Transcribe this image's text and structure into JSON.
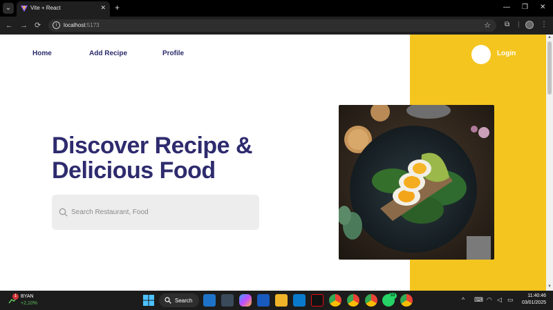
{
  "browser": {
    "tab_title": "Vite + React",
    "tab_close": "✕",
    "new_tab": "+",
    "url_host": "localhost",
    "url_port": ":5173",
    "back": "←",
    "forward": "→",
    "reload": "⟳",
    "star": "☆",
    "window_min": "—",
    "window_max": "❐",
    "window_close": "✕"
  },
  "page": {
    "nav": {
      "home": "Home",
      "add_recipe": "Add Recipe",
      "profile": "Profile",
      "login": "Login"
    },
    "hero": {
      "title": "Discover Recipe & Delicious Food"
    },
    "search": {
      "placeholder": "Search Restaurant, Food"
    },
    "colors": {
      "accent_yellow": "#f4c51f",
      "title_navy": "#2e2b6e"
    }
  },
  "taskbar": {
    "stock_name": "BYAN",
    "stock_change": "+2,10%",
    "stock_badge": "1",
    "search_label": "Search",
    "whatsapp_badge": "33",
    "time": "11:40:46",
    "date": "03/01/2025"
  }
}
